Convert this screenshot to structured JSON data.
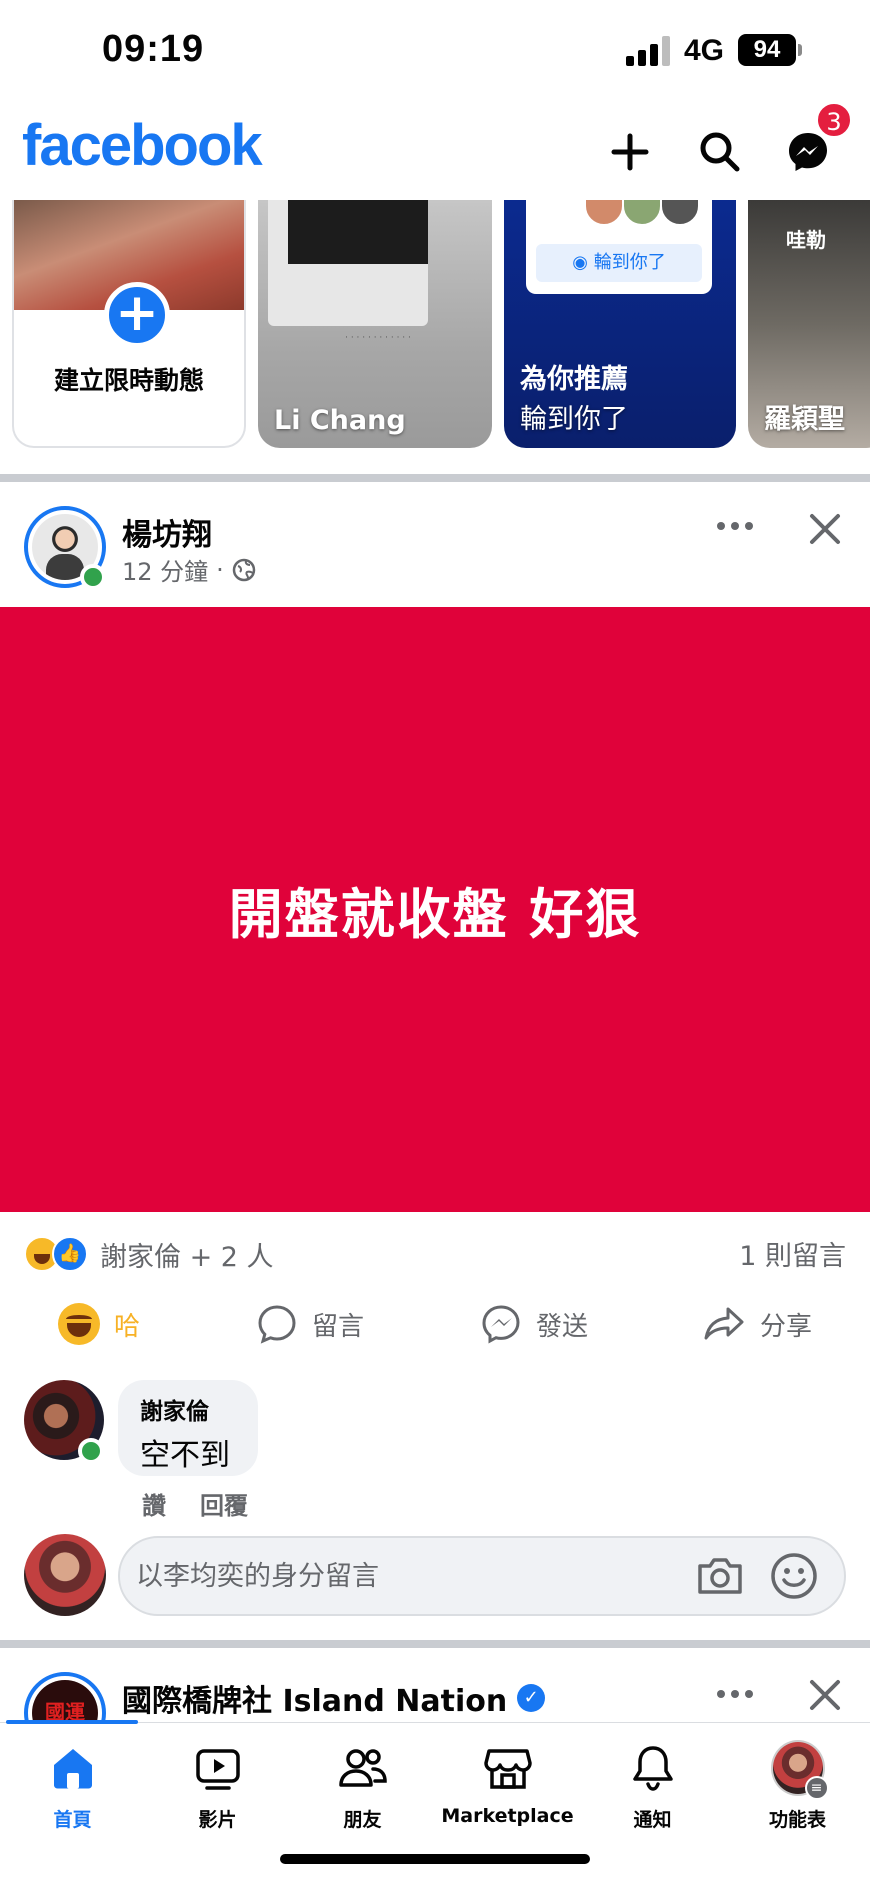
{
  "status_bar": {
    "time": "09:19",
    "network": "4G",
    "battery": "94"
  },
  "header": {
    "logo": "facebook",
    "messenger_badge": "3",
    "icons": [
      "plus-icon",
      "search-icon",
      "messenger-icon"
    ]
  },
  "stories": [
    {
      "type": "create",
      "label": "建立限時動態"
    },
    {
      "type": "story",
      "name": "Li Chang"
    },
    {
      "type": "suggestion",
      "title": "為你推薦",
      "subtitle": "輪到你了",
      "button": "輪到你了"
    },
    {
      "type": "story",
      "name": "羅穎聖",
      "overlay": "哇勒"
    }
  ],
  "post": {
    "author": "楊坊翔",
    "time": "12 分鐘",
    "privacy_icon": "globe-icon",
    "text": "開盤就收盤 好狠",
    "background_color": "#e0023a",
    "reactions_summary": "謝家倫 + 2 人",
    "comments_count": "1 則留言",
    "actions": {
      "reaction": "哈",
      "comment": "留言",
      "send": "發送",
      "share": "分享"
    }
  },
  "comment": {
    "author": "謝家倫",
    "text": "空不到",
    "like": "讚",
    "reply": "回覆"
  },
  "comment_input": {
    "placeholder": "以李均奕的身分留言"
  },
  "next_post": {
    "author": "國際橋牌社 Island Nation",
    "avatar_text": "國運"
  },
  "bottom_nav": [
    {
      "label": "首頁",
      "icon": "home-icon",
      "active": true
    },
    {
      "label": "影片",
      "icon": "video-icon"
    },
    {
      "label": "朋友",
      "icon": "friends-icon"
    },
    {
      "label": "Marketplace",
      "icon": "marketplace-icon"
    },
    {
      "label": "通知",
      "icon": "bell-icon"
    },
    {
      "label": "功能表",
      "icon": "menu-avatar"
    }
  ],
  "colors": {
    "brand": "#1877f2",
    "haha": "#f7b125",
    "online": "#31a24c"
  }
}
